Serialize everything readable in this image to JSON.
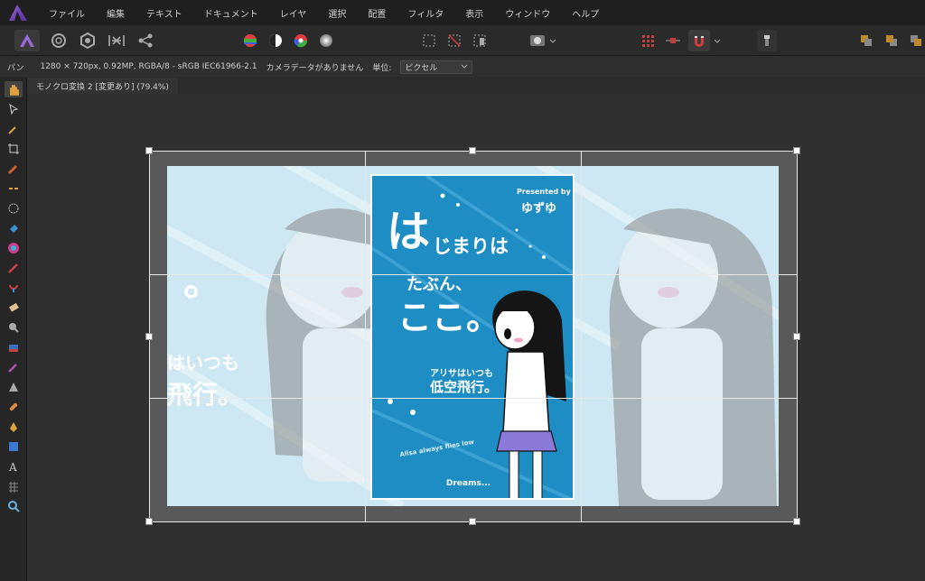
{
  "menu": [
    "ファイル",
    "編集",
    "テキスト",
    "ドキュメント",
    "レイヤ",
    "選択",
    "配置",
    "フィルタ",
    "表示",
    "ウィンドウ",
    "ヘルプ"
  ],
  "context": {
    "tool": "パン",
    "info": "1280 × 720px, 0.92MP, RGBA/8 - sRGB IEC61966-2.1",
    "camera": "カメラデータがありません",
    "unit_label": "単位:",
    "unit_value": "ピクセル"
  },
  "document": {
    "tab": "モノクロ変換 2 [変更あり] (79.4%)"
  },
  "poster": {
    "presented_by": "Presented by",
    "author": "ゆずゆ",
    "title_big": "は",
    "title_rest": "じまりは",
    "line2": "たぶん、",
    "line3": "ここ。",
    "sub1": "アリサはいつも",
    "sub2": "低空飛行。",
    "english": "Alisa always flies low",
    "dreams": "Dreams..."
  },
  "ghost_text": {
    "a": "。",
    "b": "はいつも",
    "c": "飛行。"
  },
  "colors": {
    "accent": "#8e5fd0",
    "poster_bg": "#1e8dc4",
    "canvas": "#303030"
  }
}
